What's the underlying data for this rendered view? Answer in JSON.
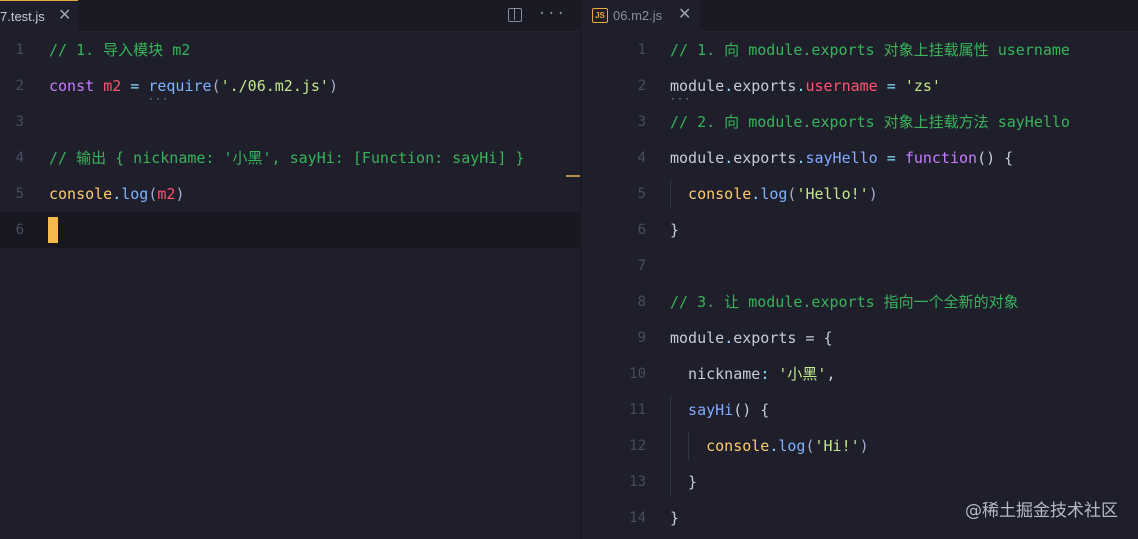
{
  "left_editor": {
    "tab_label": "7.test.js",
    "lines": [
      {
        "n": "1",
        "parts": [
          {
            "t": "// 1. 导入模块 m2",
            "c": "comment"
          }
        ]
      },
      {
        "n": "2",
        "parts": [
          {
            "t": "const ",
            "c": "keyword"
          },
          {
            "t": "m2",
            "c": "var"
          },
          {
            "t": " = ",
            "c": "punc"
          },
          {
            "t": "require",
            "c": "fn"
          },
          {
            "t": "(",
            "c": "plain"
          },
          {
            "t": "'./06.m2.js'",
            "c": "str"
          },
          {
            "t": ")",
            "c": "plain"
          }
        ]
      },
      {
        "n": "3",
        "parts": []
      },
      {
        "n": "4",
        "parts": [
          {
            "t": "// 输出 { nickname: '小黑', sayHi: [Function: sayHi] }",
            "c": "comment"
          }
        ]
      },
      {
        "n": "5",
        "parts": [
          {
            "t": "console",
            "c": "obj"
          },
          {
            "t": ".",
            "c": "punc"
          },
          {
            "t": "log",
            "c": "fn"
          },
          {
            "t": "(",
            "c": "plain"
          },
          {
            "t": "m2",
            "c": "var"
          },
          {
            "t": ")",
            "c": "plain"
          }
        ]
      },
      {
        "n": "6",
        "parts": []
      }
    ]
  },
  "right_editor": {
    "tab_label": "06.m2.js",
    "badge": "JS",
    "lines": [
      {
        "n": "1",
        "parts": [
          {
            "t": "// 1. 向 module.exports 对象上挂载属性 username",
            "c": "comment"
          }
        ]
      },
      {
        "n": "2",
        "parts": [
          {
            "t": "module",
            "c": "text"
          },
          {
            "t": ".",
            "c": "punc"
          },
          {
            "t": "exports",
            "c": "text"
          },
          {
            "t": ".",
            "c": "punc"
          },
          {
            "t": "username",
            "c": "var"
          },
          {
            "t": " = ",
            "c": "punc"
          },
          {
            "t": "'zs'",
            "c": "str"
          }
        ]
      },
      {
        "n": "3",
        "parts": [
          {
            "t": "// 2. 向 module.exports 对象上挂载方法 sayHello",
            "c": "comment"
          }
        ]
      },
      {
        "n": "4",
        "parts": [
          {
            "t": "module",
            "c": "text"
          },
          {
            "t": ".",
            "c": "punc"
          },
          {
            "t": "exports",
            "c": "text"
          },
          {
            "t": ".",
            "c": "punc"
          },
          {
            "t": "sayHello",
            "c": "prop"
          },
          {
            "t": " = ",
            "c": "punc"
          },
          {
            "t": "function",
            "c": "keyword"
          },
          {
            "t": "() {",
            "c": "text"
          }
        ]
      },
      {
        "n": "5",
        "parts": [
          {
            "t": "  console",
            "c": "obj"
          },
          {
            "t": ".",
            "c": "punc"
          },
          {
            "t": "log",
            "c": "fn"
          },
          {
            "t": "(",
            "c": "plain"
          },
          {
            "t": "'Hello!'",
            "c": "str"
          },
          {
            "t": ")",
            "c": "plain"
          }
        ]
      },
      {
        "n": "6",
        "parts": [
          {
            "t": "}",
            "c": "text"
          }
        ]
      },
      {
        "n": "7",
        "parts": []
      },
      {
        "n": "8",
        "parts": [
          {
            "t": "// 3. 让 module.exports 指向一个全新的对象",
            "c": "comment"
          }
        ]
      },
      {
        "n": "9",
        "parts": [
          {
            "t": "module",
            "c": "text"
          },
          {
            "t": ".",
            "c": "punc"
          },
          {
            "t": "exports",
            "c": "text"
          },
          {
            "t": " = {",
            "c": "text"
          }
        ]
      },
      {
        "n": "10",
        "parts": [
          {
            "t": "  nickname",
            "c": "text"
          },
          {
            "t": ": ",
            "c": "punc"
          },
          {
            "t": "'小黑'",
            "c": "str"
          },
          {
            "t": ",",
            "c": "text"
          }
        ]
      },
      {
        "n": "11",
        "parts": [
          {
            "t": "  sayHi",
            "c": "prop"
          },
          {
            "t": "() {",
            "c": "text"
          }
        ]
      },
      {
        "n": "12",
        "parts": [
          {
            "t": "    console",
            "c": "obj"
          },
          {
            "t": ".",
            "c": "punc"
          },
          {
            "t": "log",
            "c": "fn"
          },
          {
            "t": "(",
            "c": "plain"
          },
          {
            "t": "'Hi!'",
            "c": "str"
          },
          {
            "t": ")",
            "c": "plain"
          }
        ]
      },
      {
        "n": "13",
        "parts": [
          {
            "t": "  }",
            "c": "text"
          }
        ]
      },
      {
        "n": "14",
        "parts": [
          {
            "t": "}",
            "c": "text"
          }
        ]
      }
    ]
  },
  "icons": {
    "split_editor": "split-editor-icon",
    "more_actions": "more-actions-icon",
    "close_tab": "close-icon"
  },
  "toolbar": {
    "more_label": "···",
    "close_glyph": "✕"
  },
  "watermark": "@稀土掘金技术社区",
  "colors": {
    "background": "#1e1f2b",
    "cursor": "#f5b94c",
    "comment": "#38b35a",
    "string": "#c3e88d",
    "variable": "#ff5370"
  }
}
